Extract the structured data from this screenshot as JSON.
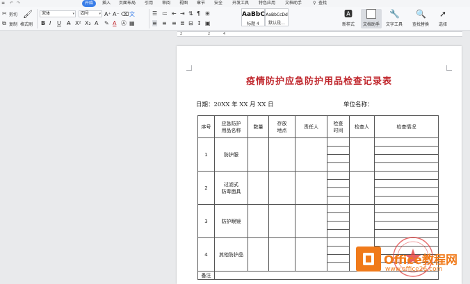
{
  "menubar": {
    "items": [
      "开始",
      "插入",
      "页面布局",
      "引用",
      "审阅",
      "视图",
      "章节",
      "安全",
      "开发工具",
      "特色应用",
      "文档助手"
    ],
    "search": "查找"
  },
  "ribbon": {
    "cut": "剪切",
    "copy": "复制",
    "format_painter": "格式刷",
    "font_name": "宋体",
    "font_size": "四号",
    "style_heading": "AaBbC",
    "style_heading_label": "标题 4",
    "style_normal": "AaBbCcDd",
    "style_normal_label": "默认段...",
    "new_style": "新样式",
    "doc_assistant": "文档助手",
    "text_tools": "文字工具",
    "find_replace": "查找替换",
    "select": "选择"
  },
  "ruler": {
    "labels": [
      "2",
      "2",
      "4"
    ]
  },
  "document": {
    "title": "疫情防护应急防护用品检查记录表",
    "date_label": "日期：20XX 年 XX 月 XX 日",
    "unit_label": "单位名称：",
    "table": {
      "headers": {
        "no": "序号",
        "name_l1": "应急防护",
        "name_l2": "用品名称",
        "qty": "数量",
        "loc_l1": "存放",
        "loc_l2": "地点",
        "owner": "责任人",
        "time_l1": "检查",
        "time_l2": "时间",
        "checker": "检查人",
        "status": "检查情况"
      },
      "rows": [
        {
          "no": "1",
          "name_l1": "防护服",
          "name_l2": ""
        },
        {
          "no": "2",
          "name_l1": "过滤式",
          "name_l2": "防毒面具"
        },
        {
          "no": "3",
          "name_l1": "防护眼镜",
          "name_l2": ""
        },
        {
          "no": "4",
          "name_l1": "其他防护品",
          "name_l2": ""
        }
      ],
      "remark": "备注"
    }
  },
  "watermark": {
    "text": "Office教程网",
    "url": "www.office26.com"
  },
  "colors": {
    "accent": "#3a7ee8",
    "title_red": "#c0272d",
    "watermark_orange": "#f07a1a"
  }
}
